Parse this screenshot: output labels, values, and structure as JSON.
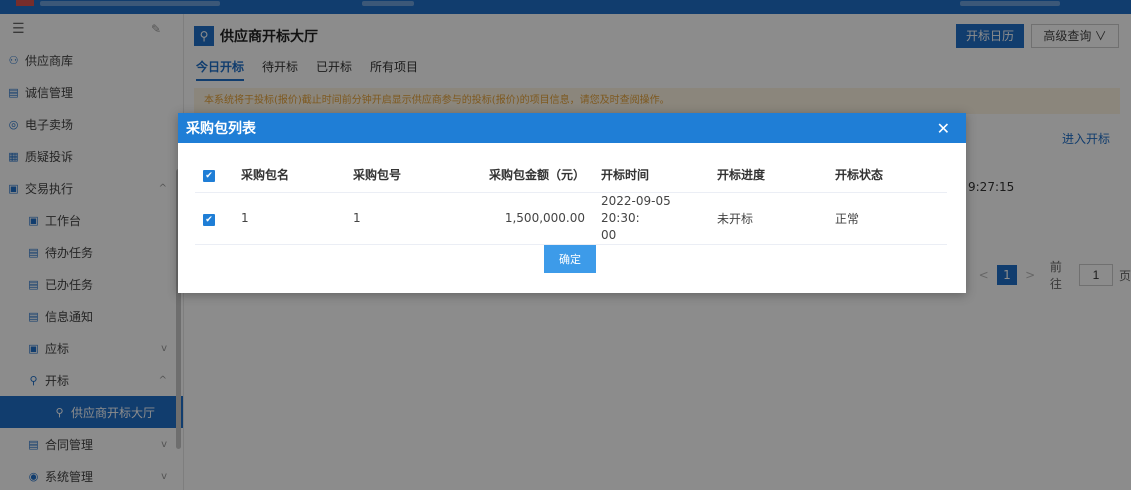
{
  "sidebar": {
    "menu_icon": "☰",
    "pin_icon": "✎",
    "items": [
      {
        "label": "供应商库",
        "icon": "user-icon",
        "glyph": "⚇"
      },
      {
        "label": "诚信管理",
        "icon": "grid-icon",
        "glyph": "▤"
      },
      {
        "label": "电子卖场",
        "icon": "shop-icon",
        "glyph": "◎"
      },
      {
        "label": "质疑投诉",
        "icon": "complaint-icon",
        "glyph": "▦"
      },
      {
        "label": "交易执行",
        "icon": "trade-icon",
        "glyph": "▣",
        "chevron": "^"
      },
      {
        "label": "工作台",
        "icon": "desk-icon",
        "glyph": "▣"
      },
      {
        "label": "待办任务",
        "icon": "todo-icon",
        "glyph": "▤"
      },
      {
        "label": "已办任务",
        "icon": "done-icon",
        "glyph": "▤"
      },
      {
        "label": "信息通知",
        "icon": "notice-icon",
        "glyph": "▤"
      },
      {
        "label": "应标",
        "icon": "bid-icon",
        "glyph": "▣",
        "chevron": "v"
      },
      {
        "label": "开标",
        "icon": "open-bid-icon",
        "glyph": "⚲",
        "chevron": "^"
      },
      {
        "label": "供应商开标大厅",
        "icon": "hall-icon",
        "glyph": "⚲"
      },
      {
        "label": "合同管理",
        "icon": "contract-icon",
        "glyph": "▤",
        "chevron": "v"
      },
      {
        "label": "系统管理",
        "icon": "settings-icon",
        "glyph": "◉",
        "chevron": "v"
      }
    ]
  },
  "header": {
    "title": "供应商开标大厅",
    "title_icon": "⚲",
    "calendar_button": "开标日历",
    "advanced_search": "高级查询 ∨"
  },
  "tabs": [
    "今日开标",
    "待开标",
    "已开标",
    "所有项目"
  ],
  "notice": "本系统将于投标(报价)截止时间前分钟开启显示供应商参与的投标(报价)的项目信息，请您及时查阅操作。",
  "background_table": {
    "enter_link": "进入开标",
    "time_fragment": "9:27:15"
  },
  "pagination": {
    "prev": "<",
    "current": "1",
    "next": ">",
    "goto_label": "前往",
    "goto_value": "1",
    "page_suffix": "页"
  },
  "modal": {
    "title": "采购包列表",
    "close": "✕",
    "columns": [
      "采购包名",
      "采购包号",
      "采购包金额（元）",
      "开标时间",
      "开标进度",
      "开标状态"
    ],
    "rows": [
      {
        "name": "1",
        "number": "1",
        "amount": "1,500,000.00",
        "open_time_line1": "2022-09-05 20:30:",
        "open_time_line2": "00",
        "progress": "未开标",
        "status": "正常"
      }
    ],
    "confirm": "确定"
  }
}
